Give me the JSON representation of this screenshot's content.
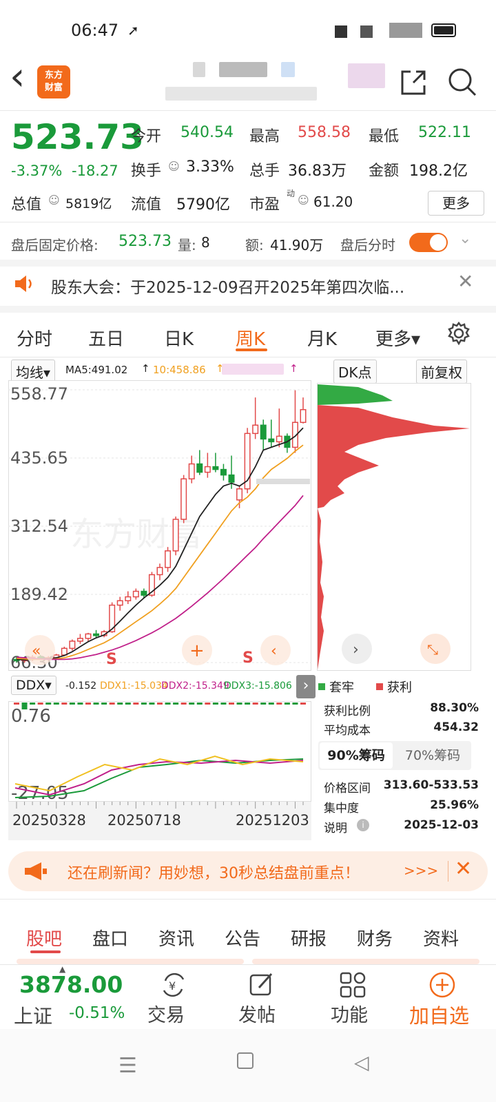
{
  "status_bar": {
    "time": "06:47"
  },
  "header": {
    "logo_text": "东方\n财富",
    "back": "‹"
  },
  "quote": {
    "price": "523.73",
    "change_pct": "-3.37%",
    "change_abs": "-18.27",
    "open_label": "今开",
    "open": "540.54",
    "high_label": "最高",
    "high": "558.58",
    "low_label": "最低",
    "low": "522.11",
    "turnover_label": "换手",
    "turnover": "3.33%",
    "volume_label": "总手",
    "volume": "36.83万",
    "amount_label": "金额",
    "amount": "198.2亿",
    "mktcap_label": "总值",
    "mktcap": "5819亿",
    "float_label": "流值",
    "float_cap": "5790亿",
    "pe_label": "市盈",
    "pe_sup": "动",
    "pe": "61.20",
    "more_button": "更多"
  },
  "after_hours": {
    "label": "盘后固定价格:",
    "price": "523.73",
    "qty_label": "量:",
    "qty": "8",
    "amt_label": "额:",
    "amt": "41.90万",
    "toggle_label": "盘后分时"
  },
  "notice": {
    "text": "股东大会：于2025-12-09召开2025年第四次临..."
  },
  "chart_tabs": [
    {
      "label": "分时"
    },
    {
      "label": "五日"
    },
    {
      "label": "日K"
    },
    {
      "label": "周K"
    },
    {
      "label": "月K"
    },
    {
      "label": "更多▾"
    }
  ],
  "chart_controls": {
    "ma_select": "均线▾",
    "ma5": "MA5:491.02",
    "ma10": "10:458.86",
    "dk_button": "DK点",
    "adjust_button": "前复权"
  },
  "chart_data": {
    "type": "candlestick",
    "y_ticks": [
      "558.77",
      "435.65",
      "312.54",
      "189.42",
      "66.30"
    ],
    "ylim": [
      66.3,
      558.77
    ],
    "x_labels": [
      "20250328",
      "20250718",
      "20251203"
    ],
    "candles": [
      {
        "o": 72,
        "h": 78,
        "l": 66,
        "c": 70
      },
      {
        "o": 70,
        "h": 74,
        "l": 66,
        "c": 72
      },
      {
        "o": 72,
        "h": 80,
        "l": 69,
        "c": 76
      },
      {
        "o": 76,
        "h": 80,
        "l": 72,
        "c": 73
      },
      {
        "o": 73,
        "h": 78,
        "l": 70,
        "c": 75
      },
      {
        "o": 75,
        "h": 82,
        "l": 72,
        "c": 80
      },
      {
        "o": 80,
        "h": 95,
        "l": 78,
        "c": 92
      },
      {
        "o": 92,
        "h": 108,
        "l": 88,
        "c": 105
      },
      {
        "o": 105,
        "h": 118,
        "l": 100,
        "c": 110
      },
      {
        "o": 110,
        "h": 120,
        "l": 105,
        "c": 118
      },
      {
        "o": 118,
        "h": 125,
        "l": 110,
        "c": 115
      },
      {
        "o": 115,
        "h": 125,
        "l": 112,
        "c": 122
      },
      {
        "o": 122,
        "h": 175,
        "l": 120,
        "c": 170
      },
      {
        "o": 170,
        "h": 185,
        "l": 160,
        "c": 178
      },
      {
        "o": 178,
        "h": 195,
        "l": 172,
        "c": 185
      },
      {
        "o": 185,
        "h": 200,
        "l": 180,
        "c": 195
      },
      {
        "o": 195,
        "h": 200,
        "l": 182,
        "c": 188
      },
      {
        "o": 188,
        "h": 230,
        "l": 185,
        "c": 225
      },
      {
        "o": 225,
        "h": 245,
        "l": 215,
        "c": 238
      },
      {
        "o": 238,
        "h": 275,
        "l": 230,
        "c": 268
      },
      {
        "o": 268,
        "h": 330,
        "l": 260,
        "c": 325
      },
      {
        "o": 325,
        "h": 405,
        "l": 318,
        "c": 398
      },
      {
        "o": 398,
        "h": 440,
        "l": 390,
        "c": 425
      },
      {
        "o": 425,
        "h": 450,
        "l": 405,
        "c": 410
      },
      {
        "o": 410,
        "h": 445,
        "l": 400,
        "c": 420
      },
      {
        "o": 420,
        "h": 445,
        "l": 410,
        "c": 415
      },
      {
        "o": 415,
        "h": 425,
        "l": 395,
        "c": 405
      },
      {
        "o": 405,
        "h": 440,
        "l": 380,
        "c": 392
      },
      {
        "o": 360,
        "h": 385,
        "l": 345,
        "c": 380
      },
      {
        "o": 380,
        "h": 490,
        "l": 372,
        "c": 480
      },
      {
        "o": 480,
        "h": 545,
        "l": 470,
        "c": 495
      },
      {
        "o": 495,
        "h": 505,
        "l": 450,
        "c": 470
      },
      {
        "o": 470,
        "h": 505,
        "l": 455,
        "c": 465
      },
      {
        "o": 465,
        "h": 525,
        "l": 455,
        "c": 475
      },
      {
        "o": 475,
        "h": 480,
        "l": 445,
        "c": 455
      },
      {
        "o": 455,
        "h": 558,
        "l": 445,
        "c": 500
      },
      {
        "o": 500,
        "h": 545,
        "l": 498,
        "c": 523
      }
    ],
    "ma5": [
      72,
      71,
      72,
      73,
      73,
      75,
      79,
      86,
      95,
      104,
      111,
      116,
      127,
      141,
      156,
      170,
      183,
      194,
      206,
      220,
      240,
      270,
      300,
      330,
      350,
      370,
      385,
      390,
      385,
      395,
      420,
      450,
      455,
      460,
      465,
      475,
      490
    ],
    "ma10": [
      74,
      73,
      72,
      72,
      72,
      73,
      75,
      79,
      84,
      90,
      96,
      102,
      110,
      120,
      130,
      140,
      150,
      160,
      172,
      185,
      200,
      220,
      240,
      260,
      280,
      300,
      320,
      340,
      355,
      365,
      380,
      400,
      415,
      425,
      435,
      448,
      459
    ],
    "ma20": [
      76,
      75,
      74,
      73,
      72,
      72,
      72,
      73,
      75,
      78,
      81,
      85,
      89,
      94,
      100,
      106,
      113,
      120,
      128,
      137,
      146,
      157,
      168,
      180,
      192,
      205,
      218,
      232,
      246,
      260,
      274,
      290,
      305,
      320,
      335,
      350,
      368
    ],
    "signals": [
      {
        "label": "S"
      },
      {
        "label": "S"
      }
    ]
  },
  "ddx_panel": {
    "select": "DDX▾",
    "v0": "-0.152",
    "ddx1": "DDX1:-15.034",
    "ddx2": "DDX2:-15.349",
    "ddx3": "DDX3:-15.806",
    "y_top": "0.76",
    "y_bottom": "-27.05"
  },
  "chip_panel": {
    "legend_trapped": "套牢",
    "legend_profit": "获利",
    "profit_ratio_label": "获利比例",
    "profit_ratio": "88.30%",
    "avg_cost_label": "平均成本",
    "avg_cost": "454.32",
    "tab_90": "90%筹码",
    "tab_70": "70%筹码",
    "range_label": "价格区间",
    "range": "313.60-533.53",
    "concentration_label": "集中度",
    "concentration": "25.96%",
    "note_label": "说明",
    "note_date": "2025-12-03"
  },
  "promo": {
    "text": "还在刷新闻？用妙想，30秒总结盘前重点！",
    "arrow": ">>>"
  },
  "news_tabs": [
    {
      "label": "股吧"
    },
    {
      "label": "盘口"
    },
    {
      "label": "资讯"
    },
    {
      "label": "公告"
    },
    {
      "label": "研报"
    },
    {
      "label": "财务"
    },
    {
      "label": "资料"
    }
  ],
  "bottom_bar": {
    "index_value": "3878.00",
    "index_name": "上证",
    "index_change": "-0.51%",
    "trade": "交易",
    "post": "发帖",
    "functions": "功能",
    "add_watch": "加自选"
  },
  "colors": {
    "up": "#e24a4a",
    "down": "#1a9a3a",
    "accent": "#f26a1b",
    "ma5": "#222222",
    "ma10": "#f0a020",
    "ma20": "#c0208a"
  }
}
